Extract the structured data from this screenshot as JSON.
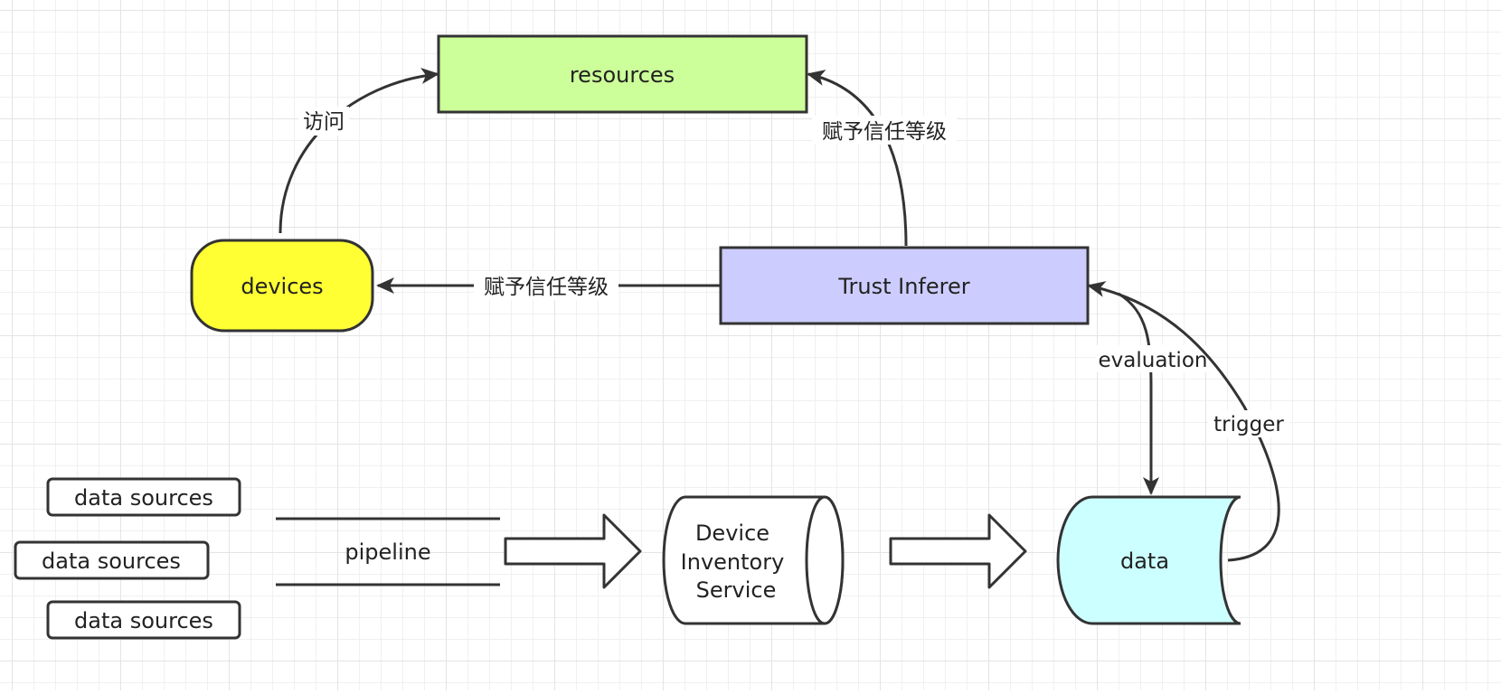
{
  "nodes": {
    "resources": {
      "label": "resources",
      "fill": "#ccff99"
    },
    "devices": {
      "label": "devices",
      "fill": "#ffff33"
    },
    "trust_inferer": {
      "label": "Trust Inferer",
      "fill": "#ccccff"
    },
    "data_sources": [
      {
        "label": "data sources"
      },
      {
        "label": "data sources"
      },
      {
        "label": "data sources"
      }
    ],
    "pipeline": {
      "label": "pipeline"
    },
    "device_inventory_service": {
      "lines": [
        "Device",
        "Inventory",
        "Service"
      ],
      "fill": "#ffffff"
    },
    "data": {
      "label": "data",
      "fill": "#ccffff"
    }
  },
  "edges": {
    "devices_to_resources": {
      "label": "访问"
    },
    "trust_to_resources": {
      "label": "赋予信任等级"
    },
    "trust_to_devices": {
      "label": "赋予信任等级"
    },
    "trust_to_data": {
      "label": "evaluation"
    },
    "data_to_trust": {
      "label": "trigger"
    }
  },
  "style": {
    "stroke": "#333333",
    "text": "#222222",
    "grid": "#e4e4e4"
  }
}
